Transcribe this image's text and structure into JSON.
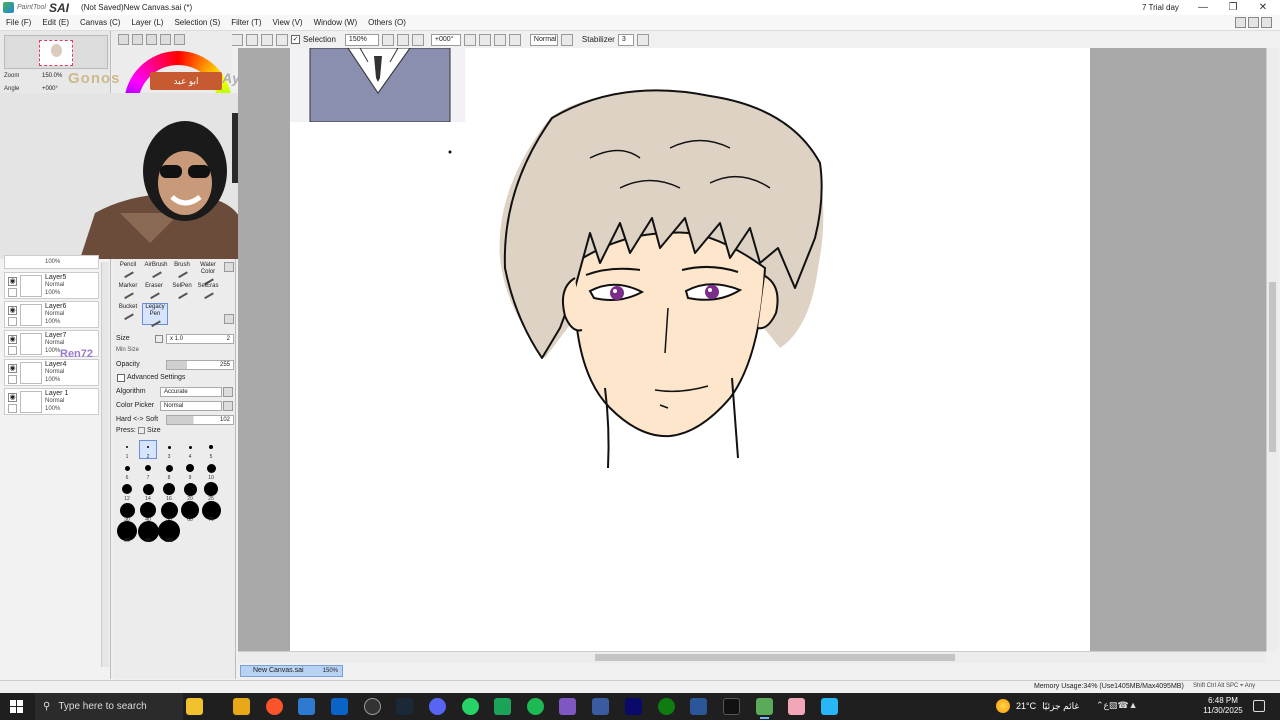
{
  "titlebar": {
    "logo_small": "PaintTool",
    "logo_big": "SAI",
    "document": "(Not Saved)New Canvas.sai (*)",
    "trial": "7 Trial day"
  },
  "menu": [
    "File (F)",
    "Edit (E)",
    "Canvas (C)",
    "Layer (L)",
    "Selection (S)",
    "Filter (T)",
    "View (V)",
    "Window (W)",
    "Others (O)"
  ],
  "toolbar": {
    "selection_label": "Selection",
    "zoom": "150%",
    "rotation": "+000°",
    "blend": "Normal",
    "stabilizer_label": "Stabilizer",
    "stabilizer_value": "3"
  },
  "navigator": {
    "zoom_label": "Zoom",
    "zoom_value": "150.0%",
    "angle_label": "Angle",
    "angle_value": "+000°"
  },
  "overlay": {
    "name": "Gonos",
    "badge": "ابو عبد",
    "ayyi": "Ayyi",
    "ren": "Ren72"
  },
  "layers": [
    {
      "name": "",
      "mode": "",
      "opacity": "100%"
    },
    {
      "name": "Layer5",
      "mode": "Normal",
      "opacity": "100%"
    },
    {
      "name": "Layer6",
      "mode": "Normal",
      "opacity": "100%"
    },
    {
      "name": "Layer7",
      "mode": "Normal",
      "opacity": "100%"
    },
    {
      "name": "Layer4",
      "mode": "Normal",
      "opacity": "100%"
    },
    {
      "name": "Layer 1",
      "mode": "Normal",
      "opacity": "100%"
    }
  ],
  "tools": [
    {
      "label": "Pencil"
    },
    {
      "label": "AirBrush"
    },
    {
      "label": "Brush"
    },
    {
      "label": "Water Color"
    },
    {
      "label": "Marker"
    },
    {
      "label": "Eraser"
    },
    {
      "label": "SelPen"
    },
    {
      "label": "SelEras"
    },
    {
      "label": "Bucket"
    },
    {
      "label": "Legacy Pen"
    }
  ],
  "brush": {
    "size_label": "Size",
    "size_mult": "x 1.0",
    "size_value": "2",
    "min_size_label": "Min Size",
    "opacity_label": "Opacity",
    "opacity_value": "255",
    "advanced_label": "Advanced Settings",
    "algorithm_label": "Algorithm",
    "algorithm_value": "Accurate",
    "picker_label": "Color Picker",
    "picker_value": "Normal",
    "hardsoft_label": "Hard <-> Soft",
    "hardsoft_value": "102",
    "press_label": "Press:",
    "press_size_label": "Size"
  },
  "brush_sizes": [
    "1",
    "2",
    "3",
    "4",
    "5",
    "6",
    "7",
    "8",
    "9",
    "10",
    "12",
    "14",
    "16",
    "20",
    "25",
    "30",
    "40",
    "50",
    "60",
    "70",
    "80",
    "90",
    "100"
  ],
  "doc_tab": {
    "name": "New Canvas.sai",
    "zoom": "150%"
  },
  "status": {
    "memory": "Memory Usage:34% (Use1405MB/Max4095MB)",
    "keys": "Shift Ctrl Alt SPC ⌖ Any"
  },
  "taskbar": {
    "search_placeholder": "Type here to search",
    "weather_temp": "21°C",
    "weather_text": "غائم جزئيًا",
    "time": "6:48 PM",
    "date": "11/30/2025",
    "lang": "ع"
  },
  "colors": {
    "hair": "#ddd2c4",
    "skin": "#fde6cc",
    "iris": "#7a2e8a",
    "accent": "#6b8fd6"
  }
}
